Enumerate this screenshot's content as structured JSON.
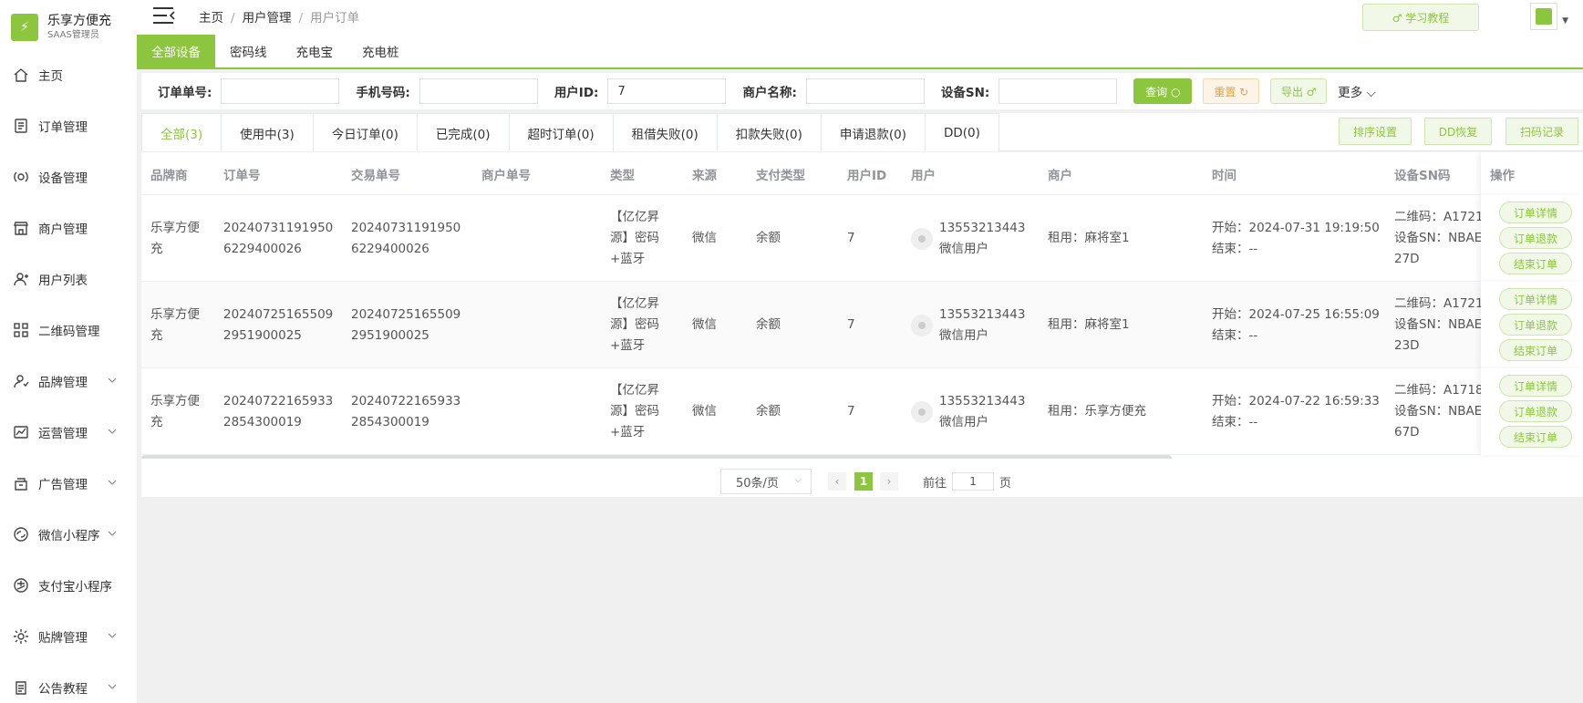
{
  "app": {
    "title": "乐享方便充",
    "subtitle": "SAAS管理员",
    "brand_color": "#8cc63f"
  },
  "sidebar": {
    "items": [
      {
        "label": "主页",
        "icon": "home-icon",
        "expandable": false
      },
      {
        "label": "订单管理",
        "icon": "order-icon",
        "expandable": false
      },
      {
        "label": "设备管理",
        "icon": "device-icon",
        "expandable": false
      },
      {
        "label": "商户管理",
        "icon": "merchant-icon",
        "expandable": false
      },
      {
        "label": "用户列表",
        "icon": "user-icon",
        "expandable": false
      },
      {
        "label": "二维码管理",
        "icon": "qrcode-icon",
        "expandable": false
      },
      {
        "label": "品牌管理",
        "icon": "brand-icon",
        "expandable": true
      },
      {
        "label": "运营管理",
        "icon": "chart-icon",
        "expandable": true
      },
      {
        "label": "广告管理",
        "icon": "ad-icon",
        "expandable": true
      },
      {
        "label": "微信小程序",
        "icon": "wechat-icon",
        "expandable": true
      },
      {
        "label": "支付宝小程序",
        "icon": "alipay-icon",
        "expandable": false
      },
      {
        "label": "贴牌管理",
        "icon": "gear-icon",
        "expandable": true
      },
      {
        "label": "公告教程",
        "icon": "notice-icon",
        "expandable": true
      }
    ]
  },
  "topbar": {
    "breadcrumb": [
      "主页",
      "用户管理",
      "用户订单"
    ],
    "learn_label": "♂ 学习教程"
  },
  "device_tabs": [
    "全部设备",
    "密码线",
    "充电宝",
    "充电桩"
  ],
  "filters": {
    "order_no_label": "订单单号:",
    "order_no_value": "",
    "phone_label": "手机号码:",
    "phone_value": "",
    "user_id_label": "用户ID:",
    "user_id_value": "7",
    "merchant_label": "商户名称:",
    "merchant_value": "",
    "sn_label": "设备SN:",
    "sn_value": "",
    "query_label": "查询 ○",
    "reset_label": "重置 ↻",
    "export_label": "导出 ♂",
    "more_label": "更多 ⌵"
  },
  "status_tabs": [
    "全部(3)",
    "使用中(3)",
    "今日订单(0)",
    "已完成(0)",
    "超时订单(0)",
    "租借失败(0)",
    "扣款失败(0)",
    "申请退款(0)",
    "DD(0)"
  ],
  "right_buttons": {
    "sort": "排序设置",
    "dd_restore": "DD恢复",
    "scan_log": "扫码记录"
  },
  "table": {
    "headers": {
      "brand": "品牌商",
      "order_no": "订单号",
      "trade_no": "交易单号",
      "merchant_no": "商户单号",
      "type": "类型",
      "source": "来源",
      "pay_type": "支付类型",
      "user_id": "用户ID",
      "user": "用户",
      "merchant": "商户",
      "time": "时间",
      "sn": "设备SN码",
      "ops": "操作"
    },
    "rows": [
      {
        "brand1": "乐享方便",
        "brand2": "充",
        "order1": "20240731191950",
        "order2": "6229400026",
        "trade1": "20240731191950",
        "trade2": "6229400026",
        "type1": "【亿亿昇",
        "type2": "源】密码",
        "type3": "+蓝牙",
        "source": "微信",
        "pay": "余额",
        "uid": "7",
        "phone": "13553213443",
        "utype": "微信用户",
        "merchant": "租用：麻将室1",
        "start": "开始：2024-07-31 19:19:50",
        "end": "结束：--",
        "sn1": "二维码：A1721",
        "sn2": "设备SN：NBAE",
        "sn3": "27D"
      },
      {
        "brand1": "乐享方便",
        "brand2": "充",
        "order1": "20240725165509",
        "order2": "2951900025",
        "trade1": "20240725165509",
        "trade2": "2951900025",
        "type1": "【亿亿昇",
        "type2": "源】密码",
        "type3": "+蓝牙",
        "source": "微信",
        "pay": "余额",
        "uid": "7",
        "phone": "13553213443",
        "utype": "微信用户",
        "merchant": "租用：麻将室1",
        "start": "开始：2024-07-25 16:55:09",
        "end": "结束：--",
        "sn1": "二维码：A1721",
        "sn2": "设备SN：NBAE",
        "sn3": "23D"
      },
      {
        "brand1": "乐享方便",
        "brand2": "充",
        "order1": "20240722165933",
        "order2": "2854300019",
        "trade1": "20240722165933",
        "trade2": "2854300019",
        "type1": "【亿亿昇",
        "type2": "源】密码",
        "type3": "+蓝牙",
        "source": "微信",
        "pay": "余额",
        "uid": "7",
        "phone": "13553213443",
        "utype": "微信用户",
        "merchant": "租用：乐享方便充",
        "start": "开始：2024-07-22 16:59:33",
        "end": "结束：--",
        "sn1": "二维码：A1718",
        "sn2": "设备SN：NBAE",
        "sn3": "67D"
      }
    ],
    "ops": {
      "detail": "订单详情",
      "refund": "订单退款",
      "finish": "结束订单"
    }
  },
  "pager": {
    "size": "50条/页",
    "current": "1",
    "goto_label": "前往",
    "goto_value": "1",
    "page_label": "页",
    "prev": "‹",
    "next": "›"
  }
}
